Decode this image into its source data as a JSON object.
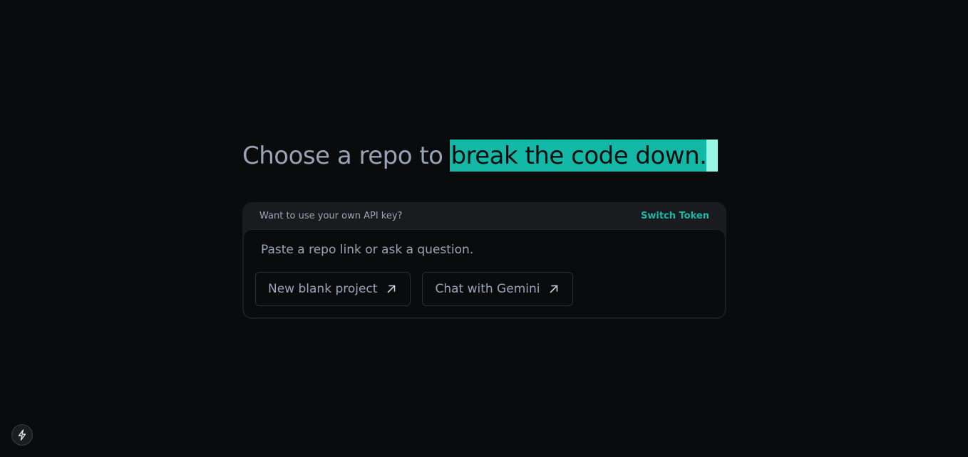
{
  "headline": {
    "plain": "Choose a repo to",
    "highlight": "break the code down."
  },
  "card": {
    "api_question": "Want to use your own API key?",
    "switch_token_label": "Switch Token",
    "input_placeholder": "Paste a repo link or ask a question.",
    "input_value": "",
    "actions": [
      {
        "label": "New blank project",
        "icon": "arrow-up-right-icon"
      },
      {
        "label": "Chat with Gemini",
        "icon": "arrow-up-right-icon"
      }
    ]
  },
  "corner_button": {
    "icon": "lightning-bolt-icon"
  },
  "colors": {
    "background": "#0a0b0d",
    "accent": "#14b8a6",
    "caret": "#99f6e4",
    "muted_text": "#9aa3b5"
  }
}
